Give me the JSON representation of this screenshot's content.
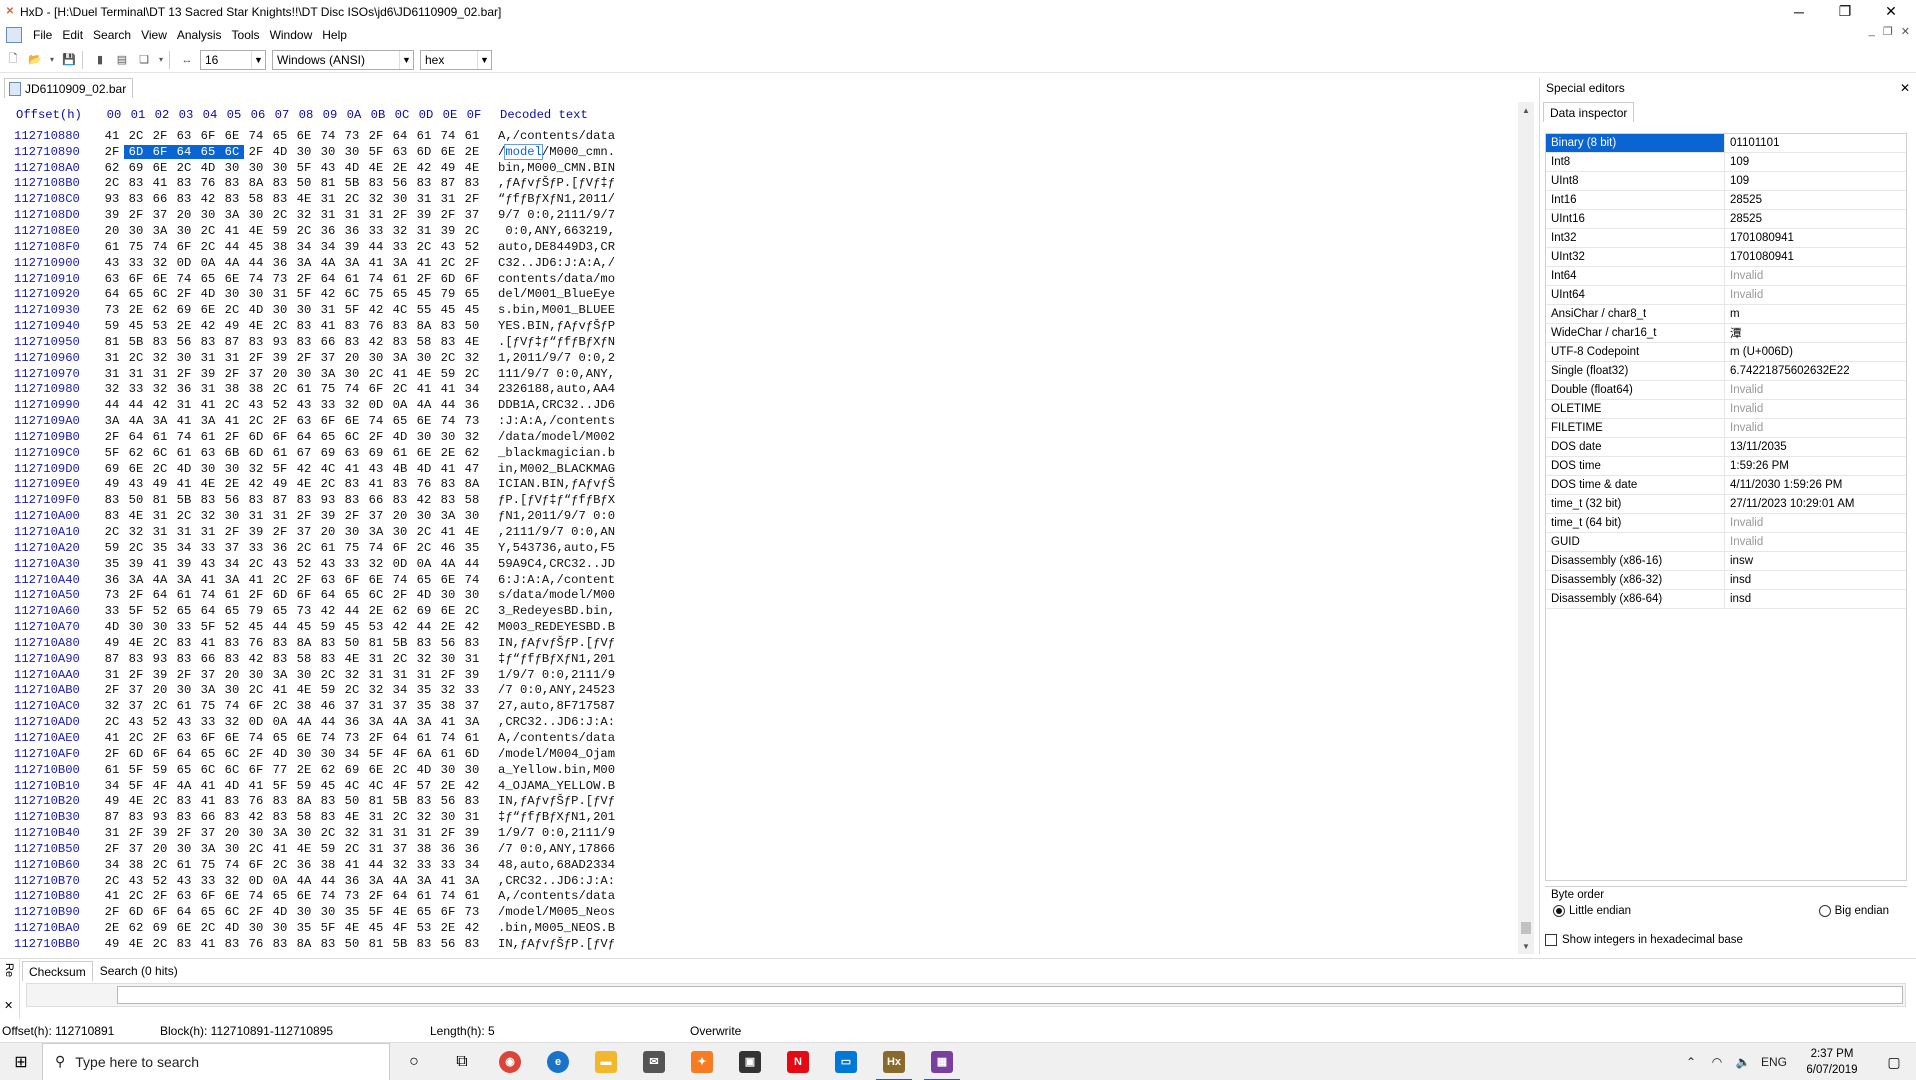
{
  "window": {
    "title": "HxD - [H:\\Duel Terminal\\DT 13 Sacred Star Knights!!\\DT Disc ISOs\\jd6\\JD6110909_02.bar]",
    "app_icon": "hxd-icon"
  },
  "menu": [
    "File",
    "Edit",
    "Search",
    "View",
    "Analysis",
    "Tools",
    "Window",
    "Help"
  ],
  "toolbar": {
    "bytes_per_row": "16",
    "charset": "Windows (ANSI)",
    "offset_base": "hex"
  },
  "document": {
    "tab_label": "JD6110909_02.bar"
  },
  "hex_view": {
    "header_offset": "Offset(h)",
    "header_columns": [
      "00",
      "01",
      "02",
      "03",
      "04",
      "05",
      "06",
      "07",
      "08",
      "09",
      "0A",
      "0B",
      "0C",
      "0D",
      "0E",
      "0F"
    ],
    "header_text": "Decoded text",
    "selection_highlight": "model",
    "rows": [
      {
        "off": "112710880",
        "bytes": "41 2C 2F 63 6F 6E 74 65 6E 74 73 2F 64 61 74 61",
        "text": "A,/contents/data"
      },
      {
        "off": "112710890",
        "bytes": "2F 6D 6F 64 65 6C 2F 4D 30 30 30 5F 63 6D 6E 2E",
        "text": "/model/M000_cmn.",
        "sel": [
          1,
          5
        ]
      },
      {
        "off": "1127108A0",
        "bytes": "62 69 6E 2C 4D 30 30 30 5F 43 4D 4E 2E 42 49 4E",
        "text": "bin,M000_CMN.BIN"
      },
      {
        "off": "1127108B0",
        "bytes": "2C 83 41 83 76 83 8A 83 50 81 5B 83 56 83 87 83",
        "text": ",ƒAƒvƒŠƒP.[ƒVƒ‡ƒ"
      },
      {
        "off": "1127108C0",
        "bytes": "93 83 66 83 42 83 58 83 4E 31 2C 32 30 31 31 2F",
        "text": "“ƒfƒBƒXƒN1,2011/"
      },
      {
        "off": "1127108D0",
        "bytes": "39 2F 37 20 30 3A 30 2C 32 31 31 31 2F 39 2F 37",
        "text": "9/7 0:0,2111/9/7"
      },
      {
        "off": "1127108E0",
        "bytes": "20 30 3A 30 2C 41 4E 59 2C 36 36 33 32 31 39 2C",
        "text": " 0:0,ANY,663219,"
      },
      {
        "off": "1127108F0",
        "bytes": "61 75 74 6F 2C 44 45 38 34 34 39 44 33 2C 43 52",
        "text": "auto,DE8449D3,CR"
      },
      {
        "off": "112710900",
        "bytes": "43 33 32 0D 0A 4A 44 36 3A 4A 3A 41 3A 41 2C 2F",
        "text": "C32..JD6:J:A:A,/"
      },
      {
        "off": "112710910",
        "bytes": "63 6F 6E 74 65 6E 74 73 2F 64 61 74 61 2F 6D 6F",
        "text": "contents/data/mo"
      },
      {
        "off": "112710920",
        "bytes": "64 65 6C 2F 4D 30 30 31 5F 42 6C 75 65 45 79 65",
        "text": "del/M001_BlueEye"
      },
      {
        "off": "112710930",
        "bytes": "73 2E 62 69 6E 2C 4D 30 30 31 5F 42 4C 55 45 45",
        "text": "s.bin,M001_BLUEE"
      },
      {
        "off": "112710940",
        "bytes": "59 45 53 2E 42 49 4E 2C 83 41 83 76 83 8A 83 50",
        "text": "YES.BIN,ƒAƒvƒŠƒP"
      },
      {
        "off": "112710950",
        "bytes": "81 5B 83 56 83 87 83 93 83 66 83 42 83 58 83 4E",
        "text": ".[ƒVƒ‡ƒ“ƒfƒBƒXƒN"
      },
      {
        "off": "112710960",
        "bytes": "31 2C 32 30 31 31 2F 39 2F 37 20 30 3A 30 2C 32",
        "text": "1,2011/9/7 0:0,2"
      },
      {
        "off": "112710970",
        "bytes": "31 31 31 2F 39 2F 37 20 30 3A 30 2C 41 4E 59 2C",
        "text": "111/9/7 0:0,ANY,"
      },
      {
        "off": "112710980",
        "bytes": "32 33 32 36 31 38 38 2C 61 75 74 6F 2C 41 41 34",
        "text": "2326188,auto,AA4"
      },
      {
        "off": "112710990",
        "bytes": "44 44 42 31 41 2C 43 52 43 33 32 0D 0A 4A 44 36",
        "text": "DDB1A,CRC32..JD6"
      },
      {
        "off": "1127109A0",
        "bytes": "3A 4A 3A 41 3A 41 2C 2F 63 6F 6E 74 65 6E 74 73",
        "text": ":J:A:A,/contents"
      },
      {
        "off": "1127109B0",
        "bytes": "2F 64 61 74 61 2F 6D 6F 64 65 6C 2F 4D 30 30 32",
        "text": "/data/model/M002"
      },
      {
        "off": "1127109C0",
        "bytes": "5F 62 6C 61 63 6B 6D 61 67 69 63 69 61 6E 2E 62",
        "text": "_blackmagician.b"
      },
      {
        "off": "1127109D0",
        "bytes": "69 6E 2C 4D 30 30 32 5F 42 4C 41 43 4B 4D 41 47",
        "text": "in,M002_BLACKMAG"
      },
      {
        "off": "1127109E0",
        "bytes": "49 43 49 41 4E 2E 42 49 4E 2C 83 41 83 76 83 8A",
        "text": "ICIAN.BIN,ƒAƒvƒŠ"
      },
      {
        "off": "1127109F0",
        "bytes": "83 50 81 5B 83 56 83 87 83 93 83 66 83 42 83 58",
        "text": "ƒP.[ƒVƒ‡ƒ“ƒfƒBƒX"
      },
      {
        "off": "112710A00",
        "bytes": "83 4E 31 2C 32 30 31 31 2F 39 2F 37 20 30 3A 30",
        "text": "ƒN1,2011/9/7 0:0"
      },
      {
        "off": "112710A10",
        "bytes": "2C 32 31 31 31 2F 39 2F 37 20 30 3A 30 2C 41 4E",
        "text": ",2111/9/7 0:0,AN"
      },
      {
        "off": "112710A20",
        "bytes": "59 2C 35 34 33 37 33 36 2C 61 75 74 6F 2C 46 35",
        "text": "Y,543736,auto,F5"
      },
      {
        "off": "112710A30",
        "bytes": "35 39 41 39 43 34 2C 43 52 43 33 32 0D 0A 4A 44",
        "text": "59A9C4,CRC32..JD"
      },
      {
        "off": "112710A40",
        "bytes": "36 3A 4A 3A 41 3A 41 2C 2F 63 6F 6E 74 65 6E 74",
        "text": "6:J:A:A,/content"
      },
      {
        "off": "112710A50",
        "bytes": "73 2F 64 61 74 61 2F 6D 6F 64 65 6C 2F 4D 30 30",
        "text": "s/data/model/M00"
      },
      {
        "off": "112710A60",
        "bytes": "33 5F 52 65 64 65 79 65 73 42 44 2E 62 69 6E 2C",
        "text": "3_RedeyesBD.bin,"
      },
      {
        "off": "112710A70",
        "bytes": "4D 30 30 33 5F 52 45 44 45 59 45 53 42 44 2E 42",
        "text": "M003_REDEYESBD.B"
      },
      {
        "off": "112710A80",
        "bytes": "49 4E 2C 83 41 83 76 83 8A 83 50 81 5B 83 56 83",
        "text": "IN,ƒAƒvƒŠƒP.[ƒVƒ"
      },
      {
        "off": "112710A90",
        "bytes": "87 83 93 83 66 83 42 83 58 83 4E 31 2C 32 30 31",
        "text": "‡ƒ“ƒfƒBƒXƒN1,201"
      },
      {
        "off": "112710AA0",
        "bytes": "31 2F 39 2F 37 20 30 3A 30 2C 32 31 31 31 2F 39",
        "text": "1/9/7 0:0,2111/9"
      },
      {
        "off": "112710AB0",
        "bytes": "2F 37 20 30 3A 30 2C 41 4E 59 2C 32 34 35 32 33",
        "text": "/7 0:0,ANY,24523"
      },
      {
        "off": "112710AC0",
        "bytes": "32 37 2C 61 75 74 6F 2C 38 46 37 31 37 35 38 37",
        "text": "27,auto,8F717587"
      },
      {
        "off": "112710AD0",
        "bytes": "2C 43 52 43 33 32 0D 0A 4A 44 36 3A 4A 3A 41 3A",
        "text": ",CRC32..JD6:J:A:"
      },
      {
        "off": "112710AE0",
        "bytes": "41 2C 2F 63 6F 6E 74 65 6E 74 73 2F 64 61 74 61",
        "text": "A,/contents/data"
      },
      {
        "off": "112710AF0",
        "bytes": "2F 6D 6F 64 65 6C 2F 4D 30 30 34 5F 4F 6A 61 6D",
        "text": "/model/M004_Ojam"
      },
      {
        "off": "112710B00",
        "bytes": "61 5F 59 65 6C 6C 6F 77 2E 62 69 6E 2C 4D 30 30",
        "text": "a_Yellow.bin,M00"
      },
      {
        "off": "112710B10",
        "bytes": "34 5F 4F 4A 41 4D 41 5F 59 45 4C 4C 4F 57 2E 42",
        "text": "4_OJAMA_YELLOW.B"
      },
      {
        "off": "112710B20",
        "bytes": "49 4E 2C 83 41 83 76 83 8A 83 50 81 5B 83 56 83",
        "text": "IN,ƒAƒvƒŠƒP.[ƒVƒ"
      },
      {
        "off": "112710B30",
        "bytes": "87 83 93 83 66 83 42 83 58 83 4E 31 2C 32 30 31",
        "text": "‡ƒ“ƒfƒBƒXƒN1,201"
      },
      {
        "off": "112710B40",
        "bytes": "31 2F 39 2F 37 20 30 3A 30 2C 32 31 31 31 2F 39",
        "text": "1/9/7 0:0,2111/9"
      },
      {
        "off": "112710B50",
        "bytes": "2F 37 20 30 3A 30 2C 41 4E 59 2C 31 37 38 36 36",
        "text": "/7 0:0,ANY,17866"
      },
      {
        "off": "112710B60",
        "bytes": "34 38 2C 61 75 74 6F 2C 36 38 41 44 32 33 33 34",
        "text": "48,auto,68AD2334"
      },
      {
        "off": "112710B70",
        "bytes": "2C 43 52 43 33 32 0D 0A 4A 44 36 3A 4A 3A 41 3A",
        "text": ",CRC32..JD6:J:A:"
      },
      {
        "off": "112710B80",
        "bytes": "41 2C 2F 63 6F 6E 74 65 6E 74 73 2F 64 61 74 61",
        "text": "A,/contents/data"
      },
      {
        "off": "112710B90",
        "bytes": "2F 6D 6F 64 65 6C 2F 4D 30 30 35 5F 4E 65 6F 73",
        "text": "/model/M005_Neos"
      },
      {
        "off": "112710BA0",
        "bytes": "2E 62 69 6E 2C 4D 30 30 35 5F 4E 45 4F 53 2E 42",
        "text": ".bin,M005_NEOS.B"
      },
      {
        "off": "112710BB0",
        "bytes": "49 4E 2C 83 41 83 76 83 8A 83 50 81 5B 83 56 83",
        "text": "IN,ƒAƒvƒŠƒP.[ƒVƒ"
      }
    ]
  },
  "special_editors": {
    "title": "Special editors",
    "tab": "Data inspector",
    "rows": [
      {
        "name": "Binary (8 bit)",
        "value": "01101101",
        "selected": true
      },
      {
        "name": "Int8",
        "value": "109"
      },
      {
        "name": "UInt8",
        "value": "109"
      },
      {
        "name": "Int16",
        "value": "28525"
      },
      {
        "name": "UInt16",
        "value": "28525"
      },
      {
        "name": "Int32",
        "value": "1701080941"
      },
      {
        "name": "UInt32",
        "value": "1701080941"
      },
      {
        "name": "Int64",
        "value": "Invalid",
        "invalid": true
      },
      {
        "name": "UInt64",
        "value": "Invalid",
        "invalid": true
      },
      {
        "name": "AnsiChar / char8_t",
        "value": "m"
      },
      {
        "name": "WideChar / char16_t",
        "value": "潭"
      },
      {
        "name": "UTF-8 Codepoint",
        "value": "m (U+006D)"
      },
      {
        "name": "Single (float32)",
        "value": "6.74221875602632E22"
      },
      {
        "name": "Double (float64)",
        "value": "Invalid",
        "invalid": true
      },
      {
        "name": "OLETIME",
        "value": "Invalid",
        "invalid": true
      },
      {
        "name": "FILETIME",
        "value": "Invalid",
        "invalid": true
      },
      {
        "name": "DOS date",
        "value": "13/11/2035"
      },
      {
        "name": "DOS time",
        "value": "1:59:26 PM"
      },
      {
        "name": "DOS time & date",
        "value": "4/11/2030 1:59:26 PM"
      },
      {
        "name": "time_t (32 bit)",
        "value": "27/11/2023 10:29:01 AM"
      },
      {
        "name": "time_t (64 bit)",
        "value": "Invalid",
        "invalid": true
      },
      {
        "name": "GUID",
        "value": "Invalid",
        "invalid": true
      },
      {
        "name": "Disassembly (x86-16)",
        "value": "insw"
      },
      {
        "name": "Disassembly (x86-32)",
        "value": "insd"
      },
      {
        "name": "Disassembly (x86-64)",
        "value": "insd"
      }
    ],
    "byte_order_label": "Byte order",
    "little_endian": "Little endian",
    "big_endian": "Big endian",
    "hex_base_label": "Show integers in hexadecimal base"
  },
  "bottom_panel": {
    "side_label": "Re",
    "tabs": [
      "Checksum",
      "Search (0 hits)"
    ]
  },
  "statusbar": {
    "offset": "Offset(h): 112710891",
    "block": "Block(h): 112710891-112710895",
    "length": "Length(h): 5",
    "mode": "Overwrite"
  },
  "taskbar": {
    "search_placeholder": "Type here to search",
    "language": "ENG",
    "time": "2:37 PM",
    "date": "6/07/2019"
  }
}
